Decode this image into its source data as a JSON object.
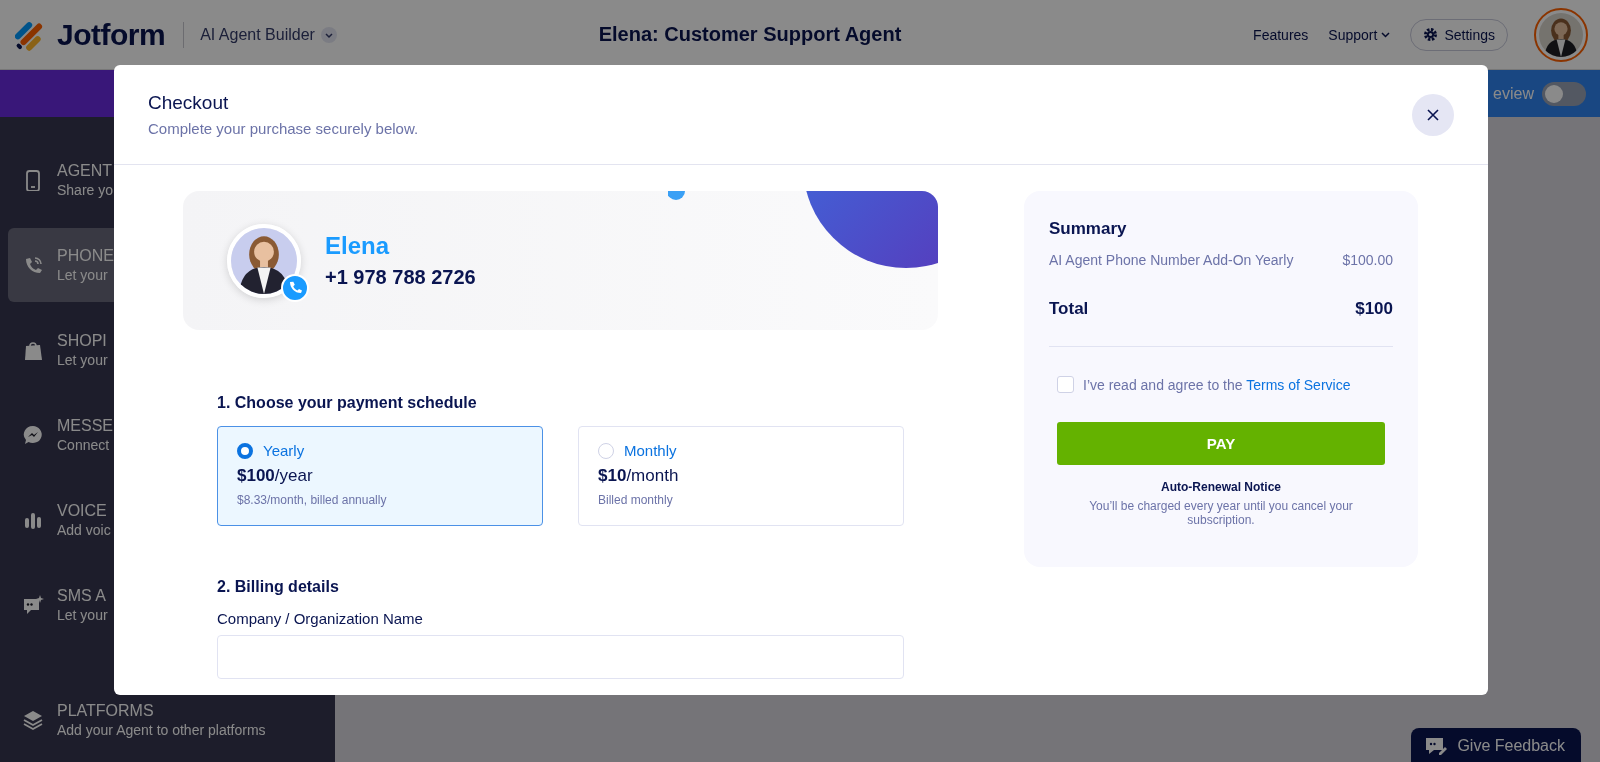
{
  "header": {
    "logo": "Jotform",
    "product": "AI Agent Builder",
    "title": "Elena: Customer Support Agent",
    "nav": [
      {
        "label": "Features",
        "kind": "link"
      },
      {
        "label": "Support",
        "kind": "dropdown"
      },
      {
        "label": "Settings",
        "kind": "button"
      }
    ]
  },
  "banner": {
    "toggle_label": "eview",
    "on": false
  },
  "sidebar": {
    "items": [
      {
        "title": "AGENT",
        "subtitle": "Share yo",
        "selected": false
      },
      {
        "title": "PHONE",
        "subtitle": "Let your",
        "selected": true
      },
      {
        "title": "SHOPI",
        "subtitle": "Let your",
        "selected": false
      },
      {
        "title": "MESSE",
        "subtitle": "Connect",
        "selected": false
      },
      {
        "title": "VOICE",
        "subtitle": "Add voic",
        "selected": false
      },
      {
        "title": "SMS A",
        "subtitle": "Let your",
        "selected": false
      },
      {
        "title": "PLATFORMS",
        "subtitle": "Add your Agent to other platforms",
        "selected": false
      }
    ]
  },
  "modal": {
    "title": "Checkout",
    "subtitle": "Complete your purchase securely below.",
    "agent": {
      "name": "Elena",
      "phone": "+1 978 788 2726"
    },
    "schedule": {
      "heading": "1. Choose your payment schedule",
      "options": [
        {
          "label": "Yearly",
          "price": "**$100**/year",
          "note": "$8.33/month, billed annually",
          "selected": true
        },
        {
          "label": "Monthly",
          "price": "**$10**/month",
          "note": "Billed monthly",
          "selected": false
        }
      ]
    },
    "billing": {
      "heading": "2. Billing details",
      "fields": [
        {
          "label": "Company / Organization Name"
        }
      ]
    },
    "summary": {
      "title": "Summary",
      "lines": [
        {
          "label": "AI Agent Phone Number Add-On Yearly",
          "amount": "$100.00"
        }
      ],
      "total_label": "Total",
      "total": "$100",
      "agree": {
        "text": "I’ve read and agree to the ",
        "link": "Terms of Service",
        "checked": false
      },
      "pay": "PAY",
      "notice_title": "Auto-Renewal Notice",
      "notice": "You’ll be charged every year until you cancel your subscription."
    }
  },
  "feedback_button": "Give Feedback"
}
